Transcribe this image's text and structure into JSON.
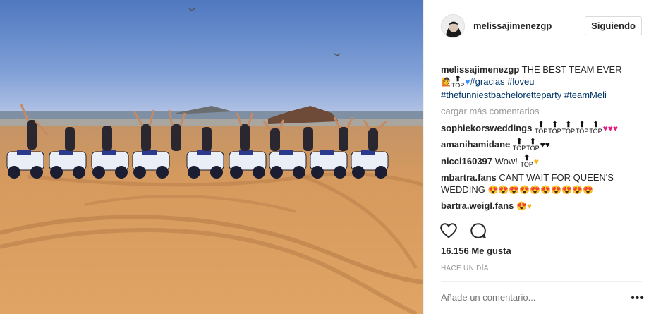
{
  "header": {
    "username": "melissajimenezgp",
    "follow_button": "Siguiendo"
  },
  "caption": {
    "username": "melissajimenezgp",
    "text": "THE BEST TEAM EVER",
    "hashtags_line1": "#gracias #loveu",
    "hashtags_line2": "#thefunniestbacheloretteparty #teamMeli"
  },
  "load_more": "cargar más comentarios",
  "comments": [
    {
      "username": "sophiekorsweddings"
    },
    {
      "username": "amanihamidane"
    },
    {
      "username": "nicci160397",
      "text": "Wow!"
    },
    {
      "username": "mbartra.fans",
      "text": "CANT WAIT FOR QUEEN'S WEDDING"
    },
    {
      "username": "bartra.weigl.fans"
    }
  ],
  "likes": "16.156 Me gusta",
  "timestamp": "HACE UN DÍA",
  "comment_input": {
    "placeholder": "Añade un comentario..."
  },
  "icons": [
    "heart-outline-icon",
    "comment-bubble-icon",
    "more-options-icon",
    "top-arrow-emoji",
    "heart-emoji",
    "smiling-eyes-emoji"
  ],
  "top_emoji_label": "TOP",
  "colors": {
    "link": "#003569",
    "muted": "#999999",
    "sky": "#5a7fc0",
    "sand": "#d89a5f"
  }
}
